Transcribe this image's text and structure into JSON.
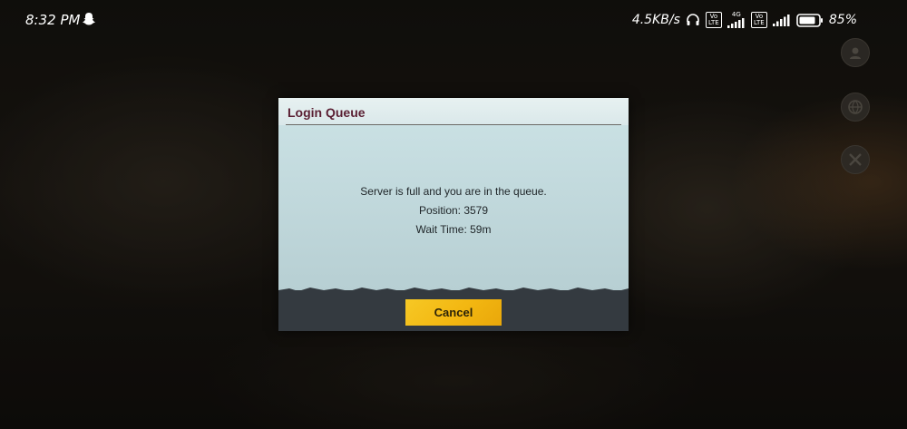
{
  "status_bar": {
    "time": "8:32 PM",
    "app_icon": "snapchat-ghost-icon",
    "net_speed": "4.5KB/s",
    "headphone_icon": "headphones-icon",
    "volte_label": "Vo LTE",
    "network_type": "4G",
    "battery_percent": "85%",
    "battery_level": 0.85,
    "signal_icon": "signal-bars-icon"
  },
  "side_menu": {
    "items": [
      {
        "icon": "help-icon"
      },
      {
        "icon": "globe-icon"
      },
      {
        "icon": "tools-icon"
      }
    ]
  },
  "dialog": {
    "title": "Login Queue",
    "message": "Server is full and you are in the queue.",
    "position_text": "Position: 3579",
    "wait_text": "Wait Time: 59m",
    "cancel_label": "Cancel",
    "accent_color": "#f3b711",
    "title_color": "#5a1f33"
  }
}
